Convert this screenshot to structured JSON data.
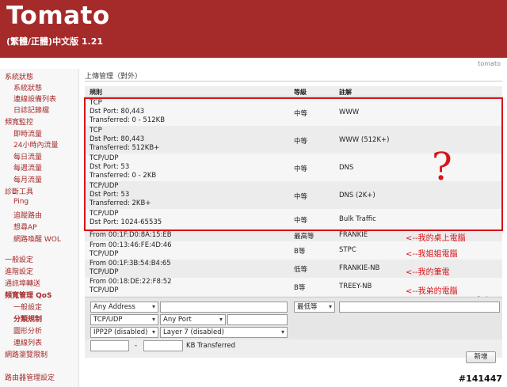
{
  "header": {
    "title": "Tomato",
    "subtitle": "(繁體/正體)中文版 1.21",
    "brand": "tomato"
  },
  "sidebar": {
    "items": [
      {
        "label": "系統狀態",
        "level": "main"
      },
      {
        "label": "系統狀態",
        "level": "sub"
      },
      {
        "label": "連線設備列表",
        "level": "sub"
      },
      {
        "label": "日誌記錄檔",
        "level": "sub"
      },
      {
        "label": "頻寬監控",
        "level": "main"
      },
      {
        "label": "即時流量",
        "level": "sub"
      },
      {
        "label": "24小時內流量",
        "level": "sub"
      },
      {
        "label": "每日流量",
        "level": "sub"
      },
      {
        "label": "每週流量",
        "level": "sub"
      },
      {
        "label": "每月流量",
        "level": "sub"
      },
      {
        "label": "診斷工具",
        "level": "main"
      },
      {
        "label": "Ping",
        "level": "sub"
      },
      {
        "label": "追蹤路由",
        "level": "sub"
      },
      {
        "label": "想尋AP",
        "level": "sub"
      },
      {
        "label": "網路喚醒 WOL",
        "level": "sub"
      },
      {
        "label": "一般設定",
        "level": "main"
      },
      {
        "label": "進階設定",
        "level": "main"
      },
      {
        "label": "通訊埠轉送",
        "level": "main"
      },
      {
        "label": "頻寬管理 QoS",
        "level": "main",
        "bold": true
      },
      {
        "label": "一般設定",
        "level": "sub"
      },
      {
        "label": "分類規制",
        "level": "sub",
        "bold": true
      },
      {
        "label": "圖形分析",
        "level": "sub"
      },
      {
        "label": "連線列表",
        "level": "sub"
      },
      {
        "label": "網路瀏覽限制",
        "level": "main"
      },
      {
        "label": "路由器管理設定",
        "level": "main"
      }
    ]
  },
  "main": {
    "section_title": "上傳管理（對外）",
    "columns": [
      "規則",
      "等級",
      "註解"
    ],
    "rows": [
      {
        "rule": [
          "TCP",
          "Dst Port: 80,443",
          "Transferred: 0 - 512KB"
        ],
        "level": "中等",
        "note": "WWW"
      },
      {
        "rule": [
          "TCP",
          "Dst Port: 80,443",
          "Transferred: 512KB+"
        ],
        "level": "中等",
        "note": "WWW (512K+)"
      },
      {
        "rule": [
          "TCP/UDP",
          "Dst Port: 53",
          "Transferred: 0 - 2KB"
        ],
        "level": "中等",
        "note": "DNS"
      },
      {
        "rule": [
          "TCP/UDP",
          "Dst Port: 53",
          "Transferred: 2KB+"
        ],
        "level": "中等",
        "note": "DNS (2K+)"
      },
      {
        "rule": [
          "TCP/UDP",
          "Dst Port: 1024-65535"
        ],
        "level": "中等",
        "note": "Bulk Traffic"
      },
      {
        "rule": [
          "From 00:1F:D0:8A:15:EB"
        ],
        "level": "最高等",
        "note": "FRANKIE"
      },
      {
        "rule": [
          "From 00:13:46:FE:4D:46",
          "TCP/UDP"
        ],
        "level": "B等",
        "note": "STPC"
      },
      {
        "rule": [
          "From 00:1F:3B:54:B4:65",
          "TCP/UDP"
        ],
        "level": "低等",
        "note": "FRANKIE-NB"
      },
      {
        "rule": [
          "From 00:18:DE:22:F8:52",
          "TCP/UDP"
        ],
        "level": "B等",
        "note": "TREEY-NB"
      }
    ],
    "annotations": {
      "question_mark": "?",
      "notes": [
        "<--我的桌上電腦",
        "<--我姐姐電腦",
        "<--我的筆電",
        "<--我弟的電腦"
      ]
    },
    "row_icons": [
      "+",
      "↑",
      "↓",
      "×"
    ],
    "editor": {
      "address_select": "Any Address",
      "address_input": "",
      "level_select": "最低等",
      "note_input": "",
      "protocol_select": "TCP/UDP",
      "port_select": "Any Port",
      "port_input": "",
      "ipp2p_select": "IPP2P (disabled)",
      "layer7_select": "Layer 7 (disabled)",
      "kb_from": "",
      "kb_dash": "-",
      "kb_to": "",
      "kb_label": "KB Transferred",
      "add_button": "新增"
    }
  },
  "watermark": "#141447",
  "colors": {
    "brand": "#a52a2a",
    "annotation": "#d8141a"
  }
}
